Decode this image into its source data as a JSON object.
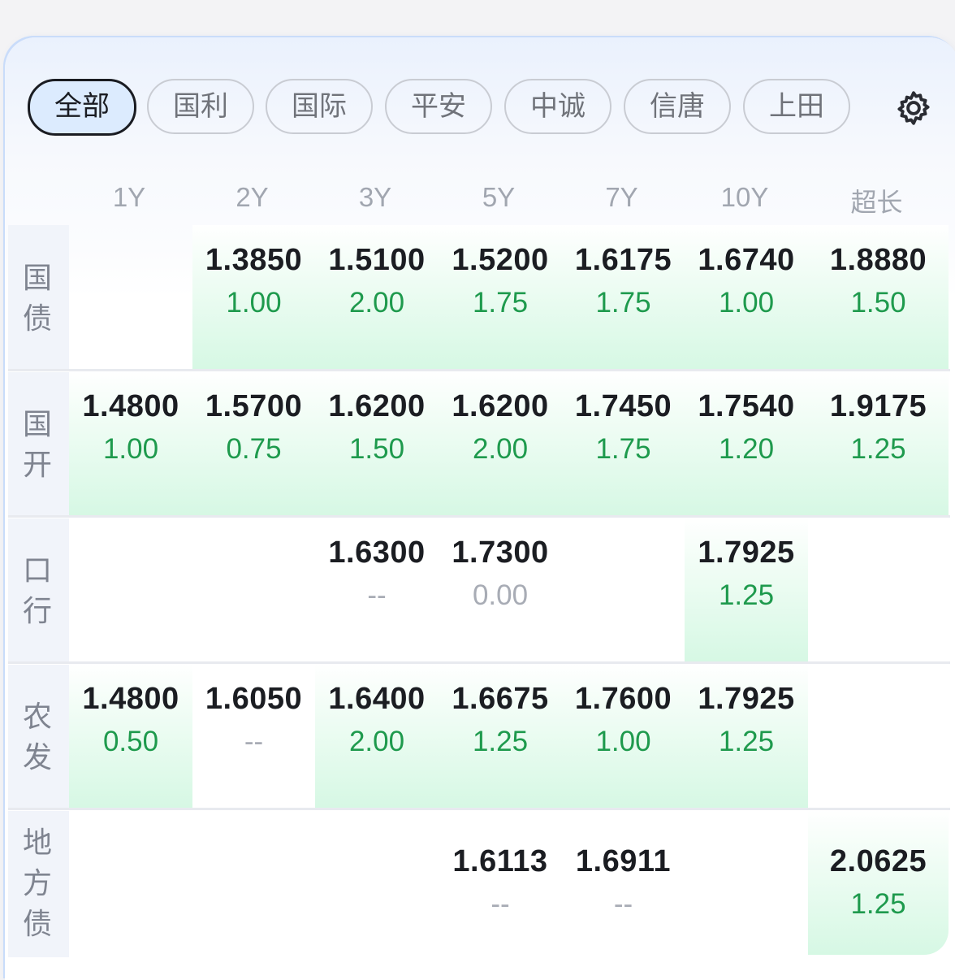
{
  "tabs": [
    {
      "label": "全部",
      "active": true
    },
    {
      "label": "国利",
      "active": false
    },
    {
      "label": "国际",
      "active": false
    },
    {
      "label": "平安",
      "active": false
    },
    {
      "label": "中诚",
      "active": false
    },
    {
      "label": "信唐",
      "active": false
    },
    {
      "label": "上田",
      "active": false
    }
  ],
  "settings_icon": "gear-icon",
  "columns": [
    "1Y",
    "2Y",
    "3Y",
    "5Y",
    "7Y",
    "10Y",
    "超长"
  ],
  "rows": [
    {
      "label": "国债",
      "cells": [
        null,
        {
          "rate": "1.3850",
          "change": "1.00"
        },
        {
          "rate": "1.5100",
          "change": "2.00"
        },
        {
          "rate": "1.5200",
          "change": "1.75"
        },
        {
          "rate": "1.6175",
          "change": "1.75"
        },
        {
          "rate": "1.6740",
          "change": "1.00"
        },
        {
          "rate": "1.8880",
          "change": "1.50"
        }
      ]
    },
    {
      "label": "国开",
      "cells": [
        {
          "rate": "1.4800",
          "change": "1.00"
        },
        {
          "rate": "1.5700",
          "change": "0.75"
        },
        {
          "rate": "1.6200",
          "change": "1.50"
        },
        {
          "rate": "1.6200",
          "change": "2.00"
        },
        {
          "rate": "1.7450",
          "change": "1.75"
        },
        {
          "rate": "1.7540",
          "change": "1.20"
        },
        {
          "rate": "1.9175",
          "change": "1.25"
        }
      ]
    },
    {
      "label": "口行",
      "cells": [
        null,
        null,
        {
          "rate": "1.6300",
          "change": "--"
        },
        {
          "rate": "1.7300",
          "change": "0.00"
        },
        null,
        {
          "rate": "1.7925",
          "change": "1.25"
        },
        null
      ]
    },
    {
      "label": "农发",
      "cells": [
        {
          "rate": "1.4800",
          "change": "0.50"
        },
        {
          "rate": "1.6050",
          "change": "--"
        },
        {
          "rate": "1.6400",
          "change": "2.00"
        },
        {
          "rate": "1.6675",
          "change": "1.25"
        },
        {
          "rate": "1.7600",
          "change": "1.00"
        },
        {
          "rate": "1.7925",
          "change": "1.25"
        },
        null
      ]
    },
    {
      "label": "地方债",
      "cells": [
        null,
        null,
        null,
        {
          "rate": "1.6113",
          "change": "--"
        },
        {
          "rate": "1.6911",
          "change": "--"
        },
        null,
        {
          "rate": "2.0625",
          "change": "1.25"
        }
      ]
    }
  ],
  "colors": {
    "positive": "#1e9a4d",
    "neutral": "#a8acb5",
    "highlight": "#d6f8e4",
    "active_tab": "#dcebfe"
  }
}
